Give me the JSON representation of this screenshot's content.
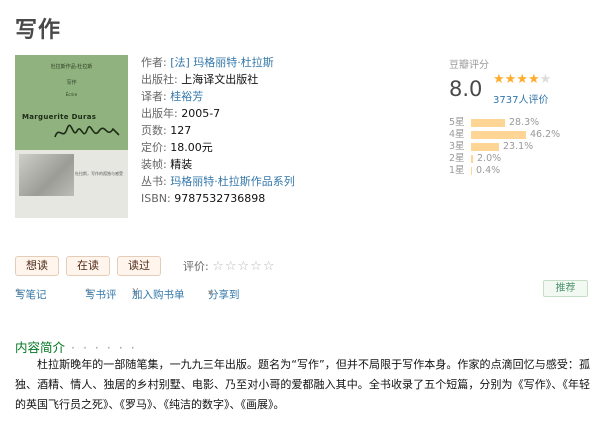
{
  "page": {
    "title": "写作"
  },
  "cover": {
    "top_text_1": "杜拉斯作品·杜拉斯",
    "top_text_2": "写作",
    "top_text_3": "Écrire",
    "author_name": "Marguerite Duras",
    "caption": "杜拉斯，写作的孤独与感受"
  },
  "info": [
    {
      "label": "作者: ",
      "value": "[法] 玛格丽特·杜拉斯",
      "link": true
    },
    {
      "label": "出版社: ",
      "value": "上海译文出版社",
      "link": false
    },
    {
      "label": "译者: ",
      "value": "桂裕芳",
      "link": true
    },
    {
      "label": "出版年: ",
      "value": "2005-7",
      "link": false
    },
    {
      "label": "页数: ",
      "value": "127",
      "link": false
    },
    {
      "label": "定价: ",
      "value": "18.00元",
      "link": false
    },
    {
      "label": "装帧: ",
      "value": "精装",
      "link": false
    },
    {
      "label": "丛书: ",
      "value": "玛格丽特·杜拉斯作品系列",
      "link": true
    },
    {
      "label": "ISBN: ",
      "value": "9787532736898",
      "link": false
    }
  ],
  "rating": {
    "title": "豆瓣评分",
    "score": "8.0",
    "stars_filled": 4,
    "stars_total": 5,
    "star_filled_char": "★",
    "star_empty_char": "★",
    "count": "3737人评价",
    "distribution": [
      {
        "label": "5星",
        "percent": "28.3%",
        "value": 28.3
      },
      {
        "label": "4星",
        "percent": "46.2%",
        "value": 46.2
      },
      {
        "label": "3星",
        "percent": "23.1%",
        "value": 23.1
      },
      {
        "label": "2星",
        "percent": "2.0%",
        "value": 2.0
      },
      {
        "label": "1星",
        "percent": "0.4%",
        "value": 0.4
      }
    ]
  },
  "buttons": {
    "want": "想读",
    "reading": "在读",
    "read": "读过",
    "rate_label": "评价:",
    "empty_stars": "☆☆☆☆☆"
  },
  "actions": {
    "note": "写笔记",
    "review": "写书评",
    "cart_icon": "¥",
    "cart": "加入购书单",
    "share": "分享到",
    "share_caret": "▾",
    "pencil_icon": "✎"
  },
  "recommend": "推荐",
  "intro": {
    "heading": "内容简介",
    "dots": "· · · · · ·",
    "text": "杜拉斯晚年的一部随笔集，一九九三年出版。题名为“写作”，但并不局限于写作本身。作家的点滴回忆与感受：孤独、酒精、情人、独居的乡村别墅、电影、乃至对小哥的爱都融入其中。全书收录了五个短篇，分别为《写作》、《年轻的英国飞行员之死》、《罗马》、《纯洁的数字》、《画展》。"
  }
}
